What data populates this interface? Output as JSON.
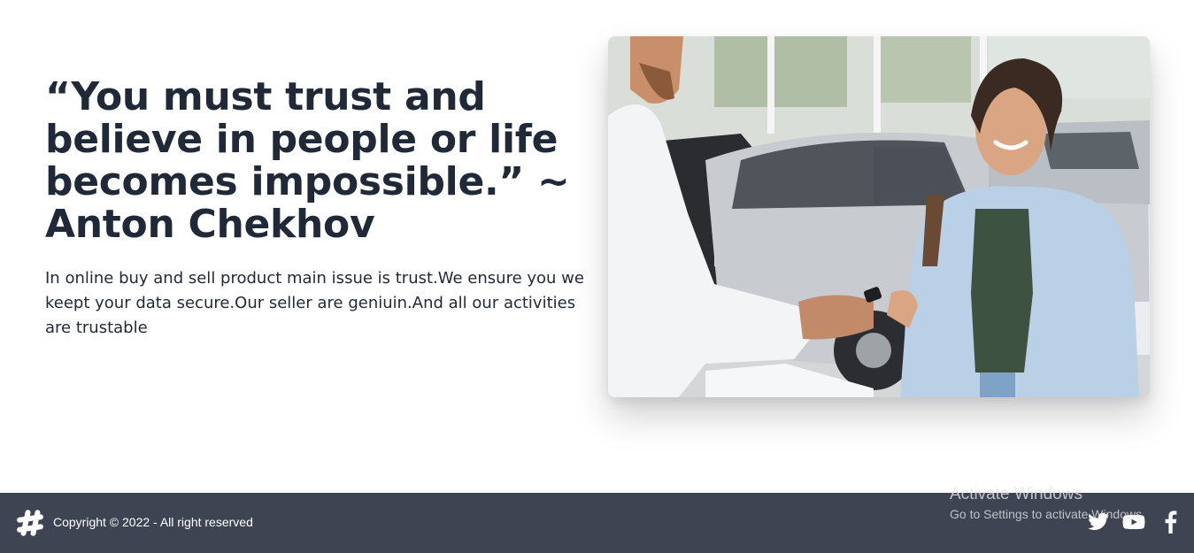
{
  "hero": {
    "quote": "“You must trust and believe in people or life becomes impossible.” ~ Anton Chekhov",
    "description": "In online buy and sell product main issue is trust.We ensure you we keept your data secure.Our seller are geniuin.And all our activities are trustable"
  },
  "photo": {
    "subject": "car-dealer-handing-keys-photo"
  },
  "footer": {
    "logo_icon": "hashtag-icon",
    "copyright": "Copyright © 2022 - All right reserved",
    "social": [
      {
        "icon": "twitter-icon"
      },
      {
        "icon": "youtube-icon"
      },
      {
        "icon": "facebook-icon"
      }
    ]
  },
  "overlay": {
    "activate_title": "Activate Windows",
    "activate_subtitle": "Go to Settings to activate Windows."
  },
  "colors": {
    "text": "#1f2937",
    "footer_bg": "#3e4451",
    "footer_text": "#ffffff"
  }
}
